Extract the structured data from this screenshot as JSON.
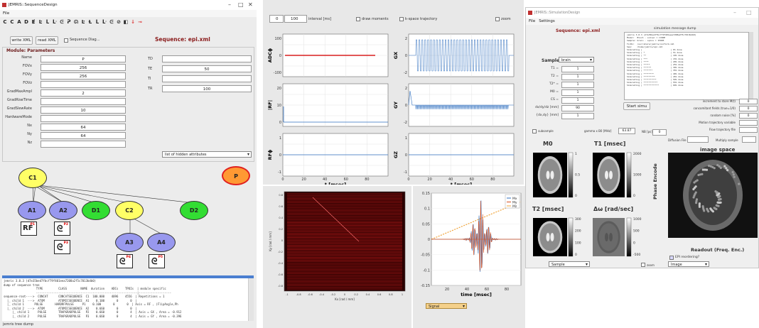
{
  "colors": {
    "accent": "#e03030",
    "param_header": "#6b1a1a",
    "plot_blue": "#2f6fbf",
    "plot_red": "#d81f1f",
    "orange": "#f0a43a",
    "lilac": "#9898ee",
    "yellow": "#ffff66",
    "green": "#33dd33",
    "node_p": "#ff9933"
  },
  "seq_window": {
    "title": "JEMRIS::SequenceDesign",
    "menu": [
      "File"
    ],
    "toolbar_icons": [
      "new-icon",
      "open-icon",
      "save-icon",
      "x-icon",
      "s-icon",
      "a-icon",
      "b-icon",
      "c-icon",
      "d-icon",
      "e-icon",
      "f-icon",
      "g-icon",
      "h-icon",
      "i-icon",
      "j-icon",
      "link-icon",
      "plot-icon",
      "arrow-icon",
      "dash-icon"
    ],
    "write_xml": "write XML",
    "read_xml": "read XML",
    "seq_diag": "Sequence Diag...",
    "seq_title": "Sequence: epi.xml",
    "module_header": "Module: Parameters",
    "params_left": [
      {
        "label": "Name",
        "value": "P"
      },
      {
        "label": "FOVx",
        "value": "256"
      },
      {
        "label": "FOVy",
        "value": "256"
      },
      {
        "label": "FOVz",
        "value": ""
      },
      {
        "label": "GradMaxAmpl",
        "value": "2"
      },
      {
        "label": "GradRiseTime",
        "value": ""
      },
      {
        "label": "GradSlewRate",
        "value": "10"
      },
      {
        "label": "HardwareMode",
        "value": ""
      },
      {
        "label": "Nx",
        "value": "64"
      },
      {
        "label": "Ny",
        "value": "64"
      },
      {
        "label": "Nz",
        "value": ""
      }
    ],
    "params_right": [
      {
        "label": "TD",
        "value": ""
      },
      {
        "label": "TE",
        "value": "50"
      },
      {
        "label": "TI",
        "value": ""
      },
      {
        "label": "TR",
        "value": "100"
      }
    ],
    "hidden_attr": "list of hidden attributes",
    "nodes": {
      "c1": "C1",
      "a1": "A1",
      "a2": "A2",
      "d1": "D1",
      "c2": "C2",
      "d2": "D2",
      "a3": "A3",
      "a4": "A4",
      "p": "P"
    },
    "pulse_nums": {
      "p1": "P1",
      "p2": "P2",
      "p3": "P3",
      "p4": "P4",
      "p5": "P5"
    },
    "console_lines": [
      "jemris 3.0.3 (d7e35bed7fbcf79f401eea7208a2f5c7013bdb0)",
      "dump of sequence tree",
      "                   TYPE         CLASS        NAME  duration    ADCs    TPOIs  | module specific",
      "                   -----------------------------------------------------------|-------------------",
      "sequence-root---->  CONCAT      CONCATSEQUENCE  C1  100.000    4096    4556  | Repetitions = 1",
      "  |_ child 1  --->  ATOM        ATOMICSEQUENCE  A1    0.100       0       0  |",
      "  |_ child 1      PULSE       HARDRFPULSE     P1    0.100       0       0  | Axis = RF , (FlipAngle,Ph",
      "  |_ child 2  --->  ATOM        ATOMICSEQUENCE  A2    0.660       0       0  |",
      "     |_ child 1     PULSE       TRAPGRADPULSE   P2    0.660       0       4  | Axis = GX , Area = -0.912",
      "     |_ child 2     PULSE       TRAPGRADPULSE   P3    0.660       0       4  | Axis = GY , Area = -0.396"
    ],
    "status": "jemris tree dump"
  },
  "plot_window": {
    "interval_from": "0",
    "interval_to": "100",
    "interval_label": "interval [ms]",
    "draw_moments": "draw moments",
    "kspace_traj": "k-space trajectory",
    "zoom": "zoom",
    "ylabels": [
      "ADCϕ",
      "|RF|",
      "RFϕ",
      "GX",
      "GY",
      "GZ"
    ],
    "xlabel": "t [msec]",
    "adc_ticks": [
      "100",
      "0",
      "-100"
    ],
    "rf_ticks": [
      "20",
      "10",
      "0"
    ],
    "rfphi_ticks": [
      "1",
      "0",
      "-1"
    ],
    "gx_ticks": [
      "2",
      "0",
      "-2"
    ],
    "gy_ticks": [
      "2",
      "0",
      "-2"
    ],
    "gz_ticks": [
      "1",
      "0",
      "-1"
    ],
    "x_ticks": [
      "0",
      "20",
      "40",
      "60",
      "80"
    ],
    "ky_label": "Ky [rad / mm]",
    "kx_label": "Kx [rad / mm]",
    "k_y_ticks": [
      "0.8",
      "0.6",
      "0.4",
      "0.2",
      "0",
      "-0.2",
      "-0.4",
      "-0.6",
      "-0.8"
    ],
    "k_x_ticks": [
      "-1",
      "-0.8",
      "-0.6",
      "-0.4",
      "-0.2",
      "0",
      "0.2",
      "0.4",
      "0.6",
      "0.8",
      "1"
    ],
    "sig_y_ticks": [
      "0.15",
      "0.1",
      "0.05",
      "0",
      "-0.05",
      "-0.1",
      "-0.15"
    ],
    "sig_x_ticks": [
      "20",
      "40",
      "60",
      "80"
    ],
    "sig_xlabel": "time [msec]",
    "legend": [
      "Mx",
      "My",
      "Mz"
    ],
    "signal_select": "Signal"
  },
  "sim_window": {
    "title": "JEMRIS::SimulationDesign",
    "menu": [
      "File",
      "Settings"
    ],
    "seq_title": "Sequence: epi.xml",
    "dump_header": "simulation message dump",
    "dump_lines": [
      "jemris 3.0.3 (d7e35bed7fbcf79f401eea7208a2f5c7013bdb0)",
      "Model:  Bloch - solver = CVODE",
      "Sample: brain - spins = 15685",
      "Tx/Rx:  /usr/share/jemris/uniform.xml",
      "Seq:    /home/jemris/epi.xml",
      "",
      "Simulating |                      | 0% done",
      "Simulating | *                    | 5% done",
      "Simulating | **                   | 10% done",
      "Simulating | ***                  | 15% done",
      "Simulating | ****                 | 20% done",
      "Simulating | *****                | 25% done",
      "Simulating | ******               | 30% done",
      "Simulating | *******              | 35% done",
      "Simulating | ********             | 40% done",
      "Simulating | *********            | 45% done",
      "Simulating | **********           | 50% done",
      "Simulating | ***********          | 55% done",
      "Simulating | ************         | 60% done"
    ],
    "sample_label": "Sample:",
    "sample_value": "brain",
    "params": [
      {
        "label": "T1 =",
        "value": "1"
      },
      {
        "label": "T2 =",
        "value": "1"
      },
      {
        "label": "T2* =",
        "value": "1"
      },
      {
        "label": "M0 =",
        "value": "1"
      },
      {
        "label": "CS =",
        "value": "1"
      },
      {
        "label": "dx/dy/dz [mm]",
        "value": "90"
      },
      {
        "label": "{dx,dy} [mm]",
        "value": "1"
      }
    ],
    "start_btn": "Start simu",
    "right_params": [
      {
        "label": "increment to store M(t)",
        "value": "0"
      },
      {
        "label": "concomitant fields (true=1/0)",
        "value": "0"
      },
      {
        "label": "random noise [%]",
        "value": "0"
      },
      {
        "label": "Motion trajectory variable",
        "value": ""
      },
      {
        "label": "Flow trajectory file",
        "value": ""
      }
    ],
    "diffusion_label": "Diffusion File",
    "multiply_label": "Multiply sample",
    "subsample": "subsample",
    "gamma_label": "gamma x B0 [MHz]",
    "gamma_value": "63.87",
    "nb_label": "NB [ps]",
    "nb_value": "0",
    "m0": "M0",
    "t1": "T1 [msec]",
    "t2": "T2 [msec]",
    "dw": "Δω [rad/sec]",
    "image_space": "image space",
    "t1_ticks": [
      "2000",
      "1000",
      "0"
    ],
    "t2_ticks": [
      "300",
      "200",
      "100",
      "0"
    ],
    "dw_ticks": [
      "1000",
      "500",
      "0",
      "-500"
    ],
    "m0_ticks": [
      "1",
      "0.5",
      "0"
    ],
    "phase_encode": "Phase Encode",
    "readout": "Readout (Freq. Enc.)",
    "epi_reorder": "EPI reordering?",
    "sample_select": "Sample",
    "zoom": "zoom",
    "image_select": "Image"
  }
}
